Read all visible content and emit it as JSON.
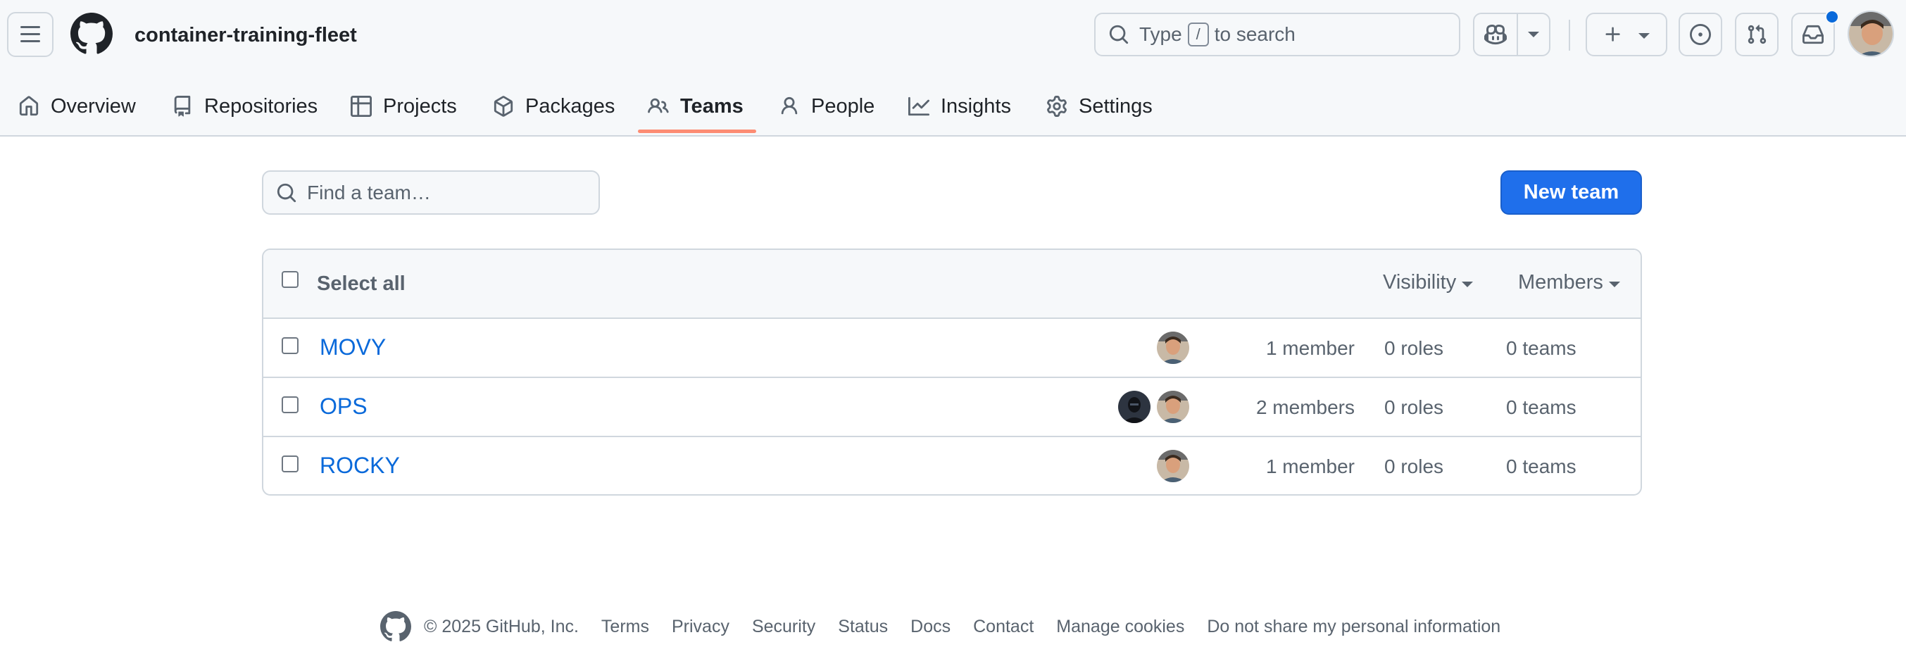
{
  "header": {
    "org_name": "container-training-fleet",
    "search_placeholder_prefix": "Type",
    "search_key": "/",
    "search_placeholder_suffix": "to search",
    "notification_color": "#0969da"
  },
  "nav": {
    "tabs": [
      {
        "label": "Overview",
        "icon": "home-icon"
      },
      {
        "label": "Repositories",
        "icon": "repo-icon"
      },
      {
        "label": "Projects",
        "icon": "table-icon"
      },
      {
        "label": "Packages",
        "icon": "package-icon"
      },
      {
        "label": "Teams",
        "icon": "people-icon",
        "selected": true
      },
      {
        "label": "People",
        "icon": "person-icon"
      },
      {
        "label": "Insights",
        "icon": "graph-icon"
      },
      {
        "label": "Settings",
        "icon": "gear-icon"
      }
    ],
    "selected_underline_color": "#fd8c73"
  },
  "toolbar": {
    "find_placeholder": "Find a team…",
    "new_team_label": "New team",
    "new_team_color": "#1f6feb"
  },
  "teams_table": {
    "select_all_label": "Select all",
    "filters": [
      {
        "label": "Visibility"
      },
      {
        "label": "Members"
      }
    ],
    "rows": [
      {
        "name": "MOVY",
        "members": "1 member",
        "roles": "0 roles",
        "teams": "0 teams"
      },
      {
        "name": "OPS",
        "members": "2 members",
        "roles": "0 roles",
        "teams": "0 teams"
      },
      {
        "name": "ROCKY",
        "members": "1 member",
        "roles": "0 roles",
        "teams": "0 teams"
      }
    ]
  },
  "footer": {
    "copyright": "© 2025 GitHub, Inc.",
    "links": [
      "Terms",
      "Privacy",
      "Security",
      "Status",
      "Docs",
      "Contact",
      "Manage cookies",
      "Do not share my personal information"
    ]
  }
}
